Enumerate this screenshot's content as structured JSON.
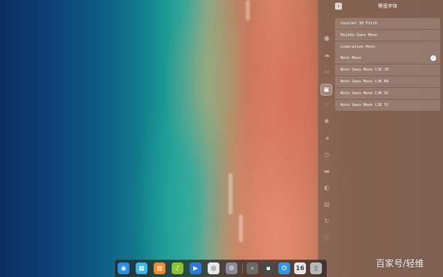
{
  "panel": {
    "title": "等宽字体",
    "back_icon": "chevron-left-icon",
    "side_icons": [
      {
        "name": "user-icon",
        "glyph": "●"
      },
      {
        "name": "cloud-icon",
        "glyph": "☁"
      },
      {
        "name": "display-icon",
        "glyph": "▭"
      },
      {
        "name": "personalization-icon",
        "glyph": "▣",
        "active": true
      },
      {
        "name": "network-icon",
        "glyph": "⟋"
      },
      {
        "name": "bluetooth-icon",
        "glyph": "✱"
      },
      {
        "name": "sound-icon",
        "glyph": "◂"
      },
      {
        "name": "datetime-icon",
        "glyph": "◷"
      },
      {
        "name": "power-icon",
        "glyph": "▬"
      },
      {
        "name": "mouse-icon",
        "glyph": "◐"
      },
      {
        "name": "keyboard-icon",
        "glyph": "▤"
      },
      {
        "name": "update-icon",
        "glyph": "↻"
      },
      {
        "name": "info-icon",
        "glyph": "ⓘ"
      }
    ],
    "fonts": [
      {
        "label": "Courier 10 Pitch",
        "selected": false
      },
      {
        "label": "DejaVu Sans Mono",
        "selected": false
      },
      {
        "label": "Liberation Mono",
        "selected": false
      },
      {
        "label": "Noto Mono",
        "selected": true
      },
      {
        "label": "Noto Sans Mono CJK JP",
        "selected": false
      },
      {
        "label": "Noto Sans Mono CJK KR",
        "selected": false
      },
      {
        "label": "Noto Sans Mono CJK SC",
        "selected": false
      },
      {
        "label": "Noto Sans Mono CJK TC",
        "selected": false
      }
    ]
  },
  "dock": {
    "items": [
      {
        "name": "launcher-icon",
        "glyph": "◉",
        "color": "#2a8fe0"
      },
      {
        "name": "file-manager-icon",
        "glyph": "▦",
        "color": "#3cb6e8"
      },
      {
        "name": "app-store-icon",
        "glyph": "▥",
        "color": "#f08a2a"
      },
      {
        "name": "music-icon",
        "glyph": "♪",
        "color": "#8ac432"
      },
      {
        "name": "video-icon",
        "glyph": "▶",
        "color": "#2a7be0"
      },
      {
        "name": "chrome-icon",
        "glyph": "◎",
        "color": "#e8e8e8"
      },
      {
        "name": "settings-icon",
        "glyph": "⚙",
        "color": "#8a8a9a"
      },
      {
        "name": "show-desktop-icon",
        "glyph": "›",
        "color": "#6a6a6a"
      },
      {
        "name": "keyboard-layout-icon",
        "glyph": "▪",
        "color": "#4a4a4a"
      },
      {
        "name": "shutdown-icon",
        "glyph": "⏻",
        "color": "#2a9ae8"
      },
      {
        "name": "monitor-icon",
        "glyph": "16",
        "color": "#e8e8e8"
      },
      {
        "name": "trash-icon",
        "glyph": "▯",
        "color": "#b8b8b8"
      }
    ]
  },
  "watermark": "百家号/轻维"
}
